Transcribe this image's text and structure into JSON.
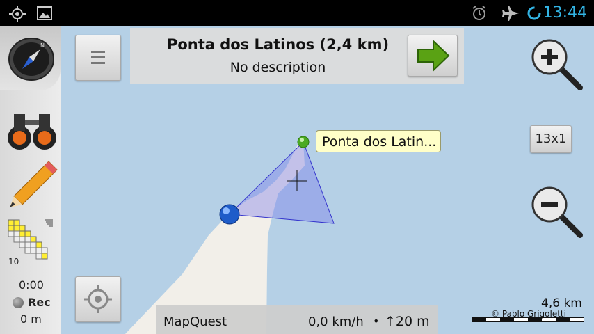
{
  "status_bar": {
    "time": "13:44",
    "icons": [
      "gps-icon",
      "image-icon",
      "alarm-icon",
      "airplane-icon",
      "sync-icon"
    ]
  },
  "info": {
    "title": "Ponta dos Latinos (2,4 km)",
    "description": "No description"
  },
  "map": {
    "poi_label": "Ponta dos Latin...",
    "zoom_level": "13x1",
    "scale": "4,6 km",
    "copyright": "© Pablo Grigoletti",
    "water_color": "#b5d0e6",
    "land_color": "#f2efe9"
  },
  "bottom_bar": {
    "map_source": "MapQuest",
    "speed": "0,0 km/h",
    "separator": "•",
    "altitude": "↑20 m"
  },
  "left_panel": {
    "grid_level": "10",
    "track_time": "0:00",
    "rec_label": "Rec",
    "track_distance": "0 m"
  }
}
